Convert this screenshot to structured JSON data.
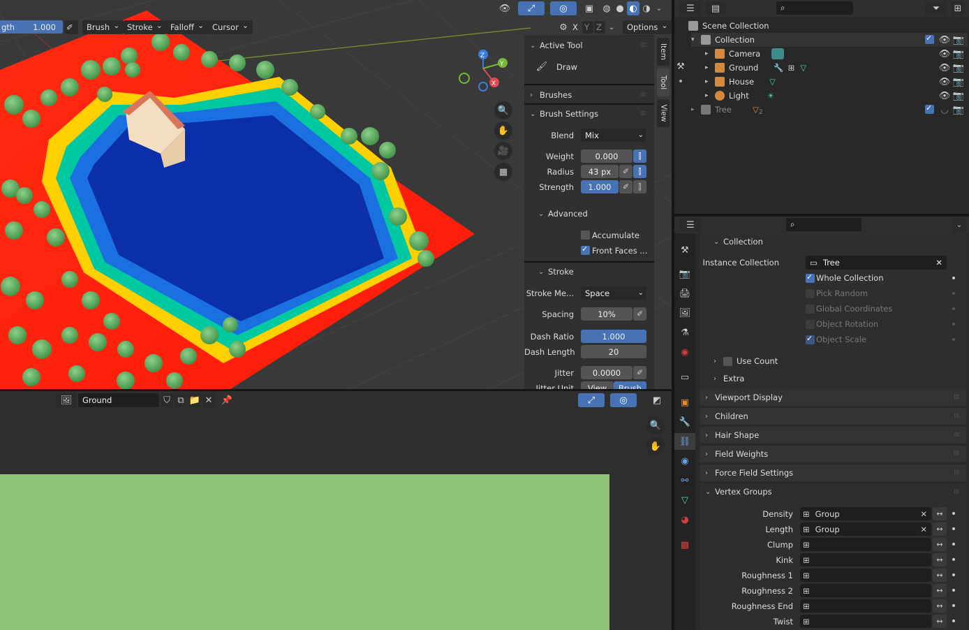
{
  "viewport": {
    "header": {
      "strength_label": "gth",
      "strength_value": "1.000",
      "menus": [
        "Brush",
        "Stroke",
        "Falloff",
        "Cursor"
      ],
      "axes": [
        "X",
        "Y",
        "Z"
      ],
      "options_label": "Options"
    },
    "tabs": [
      "Item",
      "Tool",
      "View"
    ],
    "gizmo": {
      "x": "X",
      "y": "Y",
      "z": "Z"
    }
  },
  "tool_panel": {
    "active_tool_title": "Active Tool",
    "active_tool_name": "Draw",
    "brushes": "Brushes",
    "brush_settings": "Brush Settings",
    "blend_label": "Blend",
    "blend_value": "Mix",
    "weight_label": "Weight",
    "weight_value": "0.000",
    "radius_label": "Radius",
    "radius_value": "43 px",
    "strength_label": "Strength",
    "strength_value": "1.000",
    "advanced": "Advanced",
    "accumulate": "Accumulate",
    "front_faces": "Front Faces ...",
    "stroke": "Stroke",
    "stroke_method_label": "Stroke Me...",
    "stroke_method_value": "Space",
    "spacing_label": "Spacing",
    "spacing_value": "10%",
    "dash_ratio_label": "Dash Ratio",
    "dash_ratio_value": "1.000",
    "dash_length_label": "Dash Length",
    "dash_length_value": "20",
    "jitter_label": "Jitter",
    "jitter_value": "0.0000",
    "jitter_unit_label": "Jitter Unit",
    "jitter_unit_options": [
      "View",
      "Brush"
    ]
  },
  "image_editor": {
    "image_name": "Ground"
  },
  "outliner": {
    "scene_collection": "Scene Collection",
    "items": [
      {
        "name": "Collection",
        "indent": 1
      },
      {
        "name": "Camera",
        "indent": 2
      },
      {
        "name": "Ground",
        "indent": 2
      },
      {
        "name": "House",
        "indent": 2
      },
      {
        "name": "Light",
        "indent": 2
      },
      {
        "name": "Tree",
        "indent": 1
      },
      {
        "name": "2",
        "indent": 0
      }
    ]
  },
  "properties": {
    "collection_panel": "Collection",
    "instance_collection_label": "Instance Collection",
    "instance_collection_value": "Tree",
    "whole_collection": "Whole Collection",
    "pick_random": "Pick Random",
    "global_coordinates": "Global Coordinates",
    "object_rotation": "Object Rotation",
    "object_scale": "Object Scale",
    "use_count": "Use Count",
    "extra": "Extra",
    "viewport_display": "Viewport Display",
    "children": "Children",
    "hair_shape": "Hair Shape",
    "field_weights": "Field Weights",
    "force_field_settings": "Force Field Settings",
    "vertex_groups": "Vertex Groups",
    "vg_rows": [
      {
        "label": "Density",
        "value": "Group"
      },
      {
        "label": "Length",
        "value": "Group"
      },
      {
        "label": "Clump",
        "value": ""
      },
      {
        "label": "Kink",
        "value": ""
      },
      {
        "label": "Roughness 1",
        "value": ""
      },
      {
        "label": "Roughness 2",
        "value": ""
      },
      {
        "label": "Roughness End",
        "value": ""
      },
      {
        "label": "Twist",
        "value": ""
      }
    ]
  },
  "colors": {
    "accent_blue": "#4772b3",
    "bg_panel": "#303030",
    "image_green": "#8fc476"
  }
}
